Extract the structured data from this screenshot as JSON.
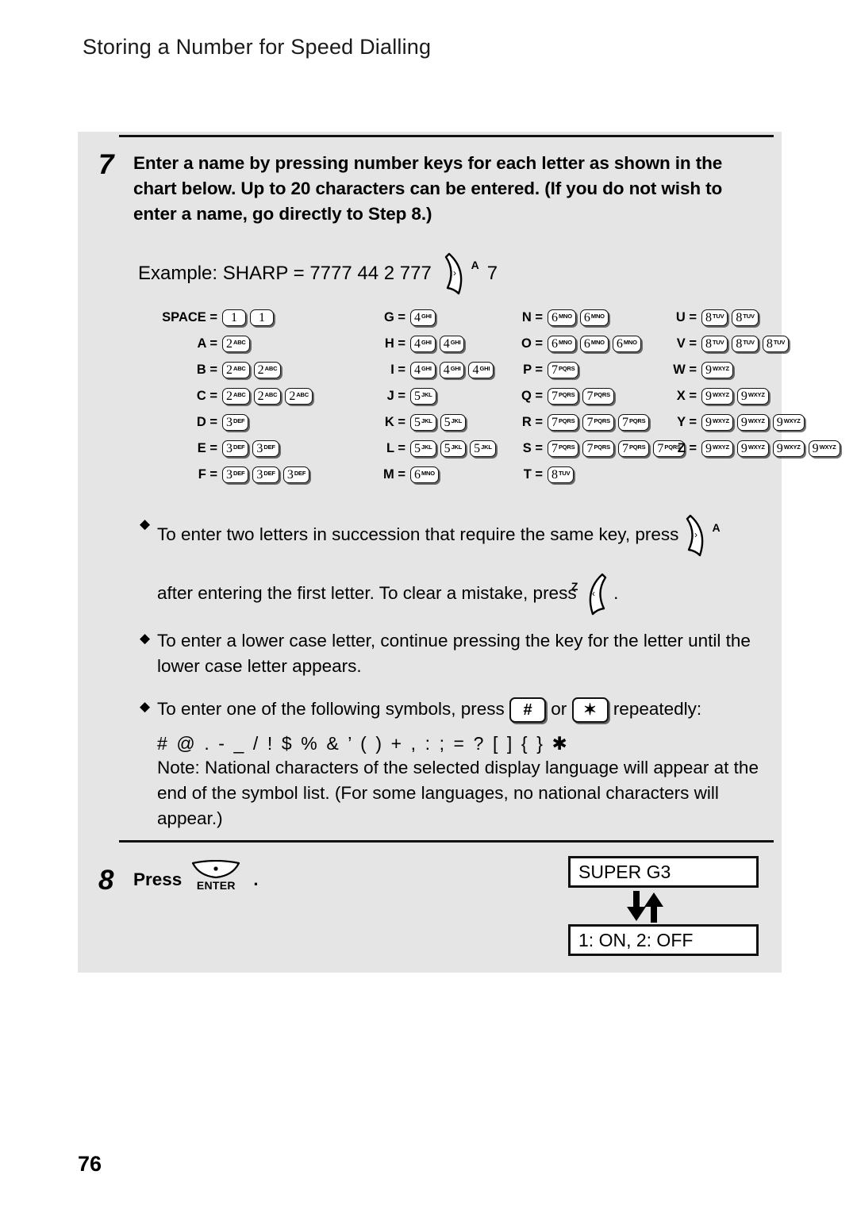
{
  "page": {
    "header_title": "Storing a Number for Speed Dialling",
    "page_number": "76"
  },
  "step7": {
    "number": "7",
    "text": "Enter a name by pressing number keys for each letter as shown in the chart below. Up to 20 characters can be entered. (If you do not wish to enter a name, go directly to Step 8.)"
  },
  "example": {
    "prefix": "Example: SHARP = 7777  44  2  777",
    "key_icon_letter": "A",
    "suffix": "7"
  },
  "chart": {
    "columns": [
      {
        "rows": [
          {
            "label": "SPACE =",
            "keys": [
              {
                "digit": "1",
                "letters": ""
              },
              {
                "digit": "1",
                "letters": ""
              }
            ]
          },
          {
            "label": "A =",
            "keys": [
              {
                "digit": "2",
                "letters": "ABC"
              }
            ]
          },
          {
            "label": "B =",
            "keys": [
              {
                "digit": "2",
                "letters": "ABC"
              },
              {
                "digit": "2",
                "letters": "ABC"
              }
            ]
          },
          {
            "label": "C =",
            "keys": [
              {
                "digit": "2",
                "letters": "ABC"
              },
              {
                "digit": "2",
                "letters": "ABC"
              },
              {
                "digit": "2",
                "letters": "ABC"
              }
            ]
          },
          {
            "label": "D =",
            "keys": [
              {
                "digit": "3",
                "letters": "DEF"
              }
            ]
          },
          {
            "label": "E =",
            "keys": [
              {
                "digit": "3",
                "letters": "DEF"
              },
              {
                "digit": "3",
                "letters": "DEF"
              }
            ]
          },
          {
            "label": "F =",
            "keys": [
              {
                "digit": "3",
                "letters": "DEF"
              },
              {
                "digit": "3",
                "letters": "DEF"
              },
              {
                "digit": "3",
                "letters": "DEF"
              }
            ]
          }
        ]
      },
      {
        "rows": [
          {
            "label": "G =",
            "keys": [
              {
                "digit": "4",
                "letters": "GHI"
              }
            ]
          },
          {
            "label": "H =",
            "keys": [
              {
                "digit": "4",
                "letters": "GHI"
              },
              {
                "digit": "4",
                "letters": "GHI"
              }
            ]
          },
          {
            "label": "I =",
            "keys": [
              {
                "digit": "4",
                "letters": "GHI"
              },
              {
                "digit": "4",
                "letters": "GHI"
              },
              {
                "digit": "4",
                "letters": "GHI"
              }
            ]
          },
          {
            "label": "J =",
            "keys": [
              {
                "digit": "5",
                "letters": "JKL"
              }
            ]
          },
          {
            "label": "K =",
            "keys": [
              {
                "digit": "5",
                "letters": "JKL"
              },
              {
                "digit": "5",
                "letters": "JKL"
              }
            ]
          },
          {
            "label": "L =",
            "keys": [
              {
                "digit": "5",
                "letters": "JKL"
              },
              {
                "digit": "5",
                "letters": "JKL"
              },
              {
                "digit": "5",
                "letters": "JKL"
              }
            ]
          },
          {
            "label": "M =",
            "keys": [
              {
                "digit": "6",
                "letters": "MNO"
              }
            ]
          }
        ]
      },
      {
        "rows": [
          {
            "label": "N =",
            "keys": [
              {
                "digit": "6",
                "letters": "MNO"
              },
              {
                "digit": "6",
                "letters": "MNO"
              }
            ]
          },
          {
            "label": "O =",
            "keys": [
              {
                "digit": "6",
                "letters": "MNO"
              },
              {
                "digit": "6",
                "letters": "MNO"
              },
              {
                "digit": "6",
                "letters": "MNO"
              }
            ]
          },
          {
            "label": "P =",
            "keys": [
              {
                "digit": "7",
                "letters": "PQRS"
              }
            ]
          },
          {
            "label": "Q =",
            "keys": [
              {
                "digit": "7",
                "letters": "PQRS"
              },
              {
                "digit": "7",
                "letters": "PQRS"
              }
            ]
          },
          {
            "label": "R =",
            "keys": [
              {
                "digit": "7",
                "letters": "PQRS"
              },
              {
                "digit": "7",
                "letters": "PQRS"
              },
              {
                "digit": "7",
                "letters": "PQRS"
              }
            ]
          },
          {
            "label": "S =",
            "keys": [
              {
                "digit": "7",
                "letters": "PQRS"
              },
              {
                "digit": "7",
                "letters": "PQRS"
              },
              {
                "digit": "7",
                "letters": "PQRS"
              },
              {
                "digit": "7",
                "letters": "PQRS"
              }
            ]
          },
          {
            "label": "T =",
            "keys": [
              {
                "digit": "8",
                "letters": "TUV"
              }
            ]
          }
        ]
      },
      {
        "rows": [
          {
            "label": "U =",
            "keys": [
              {
                "digit": "8",
                "letters": "TUV"
              },
              {
                "digit": "8",
                "letters": "TUV"
              }
            ]
          },
          {
            "label": "V =",
            "keys": [
              {
                "digit": "8",
                "letters": "TUV"
              },
              {
                "digit": "8",
                "letters": "TUV"
              },
              {
                "digit": "8",
                "letters": "TUV"
              }
            ]
          },
          {
            "label": "W =",
            "keys": [
              {
                "digit": "9",
                "letters": "WXYZ"
              }
            ]
          },
          {
            "label": "X =",
            "keys": [
              {
                "digit": "9",
                "letters": "WXYZ"
              },
              {
                "digit": "9",
                "letters": "WXYZ"
              }
            ]
          },
          {
            "label": "Y =",
            "keys": [
              {
                "digit": "9",
                "letters": "WXYZ"
              },
              {
                "digit": "9",
                "letters": "WXYZ"
              },
              {
                "digit": "9",
                "letters": "WXYZ"
              }
            ]
          },
          {
            "label": "Z =",
            "keys": [
              {
                "digit": "9",
                "letters": "WXYZ"
              },
              {
                "digit": "9",
                "letters": "WXYZ"
              },
              {
                "digit": "9",
                "letters": "WXYZ"
              },
              {
                "digit": "9",
                "letters": "WXYZ"
              }
            ]
          }
        ]
      }
    ]
  },
  "bullets": {
    "b1_line1": "To enter two letters in succession that require the same key, press",
    "b1_icon_letter": "A",
    "b1_line2a": "after entering the first letter. To clear a mistake, press",
    "b1_icon2_letter": "Z",
    "b1_line2b": ".",
    "b2": "To enter a lower case letter, continue pressing the key for the letter until the lower case letter appears.",
    "b3_pre": "To enter one of the following symbols, press",
    "b3_key1": "#",
    "b3_mid": "or",
    "b3_key2": "✶",
    "b3_post": "repeatedly:",
    "symbol_list": "# @ . - _ / ! $ % & ’ ( ) + , : ; = ? [ ] { } ✱",
    "note": "Note: National characters of the selected display language will appear at the end of the symbol list. (For some languages, no national characters will appear.)"
  },
  "step8": {
    "number": "8",
    "press_label": "Press",
    "enter_key_label": "ENTER",
    "trailing": "."
  },
  "display": {
    "line1": "SUPER G3",
    "line2": "1: ON, 2: OFF"
  }
}
